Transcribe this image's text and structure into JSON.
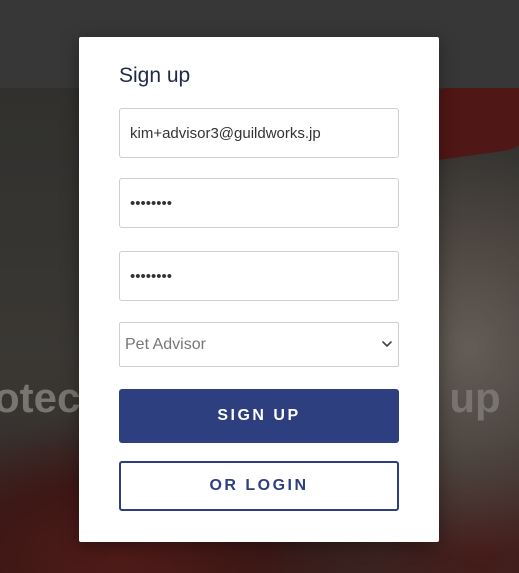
{
  "background": {
    "hero_text_left": "otec",
    "hero_text_right": "n up"
  },
  "modal": {
    "title": "Sign up",
    "email_value": "kim+advisor3@guildworks.jp",
    "password_value": "••••••••",
    "confirm_password_value": "••••••••",
    "role_select": {
      "selected": "Pet Advisor",
      "options": [
        "Pet Advisor"
      ]
    },
    "signup_button": "SIGN UP",
    "login_button": "OR LOGIN"
  },
  "colors": {
    "primary": "#2e3f80",
    "title": "#1e2a4a"
  }
}
